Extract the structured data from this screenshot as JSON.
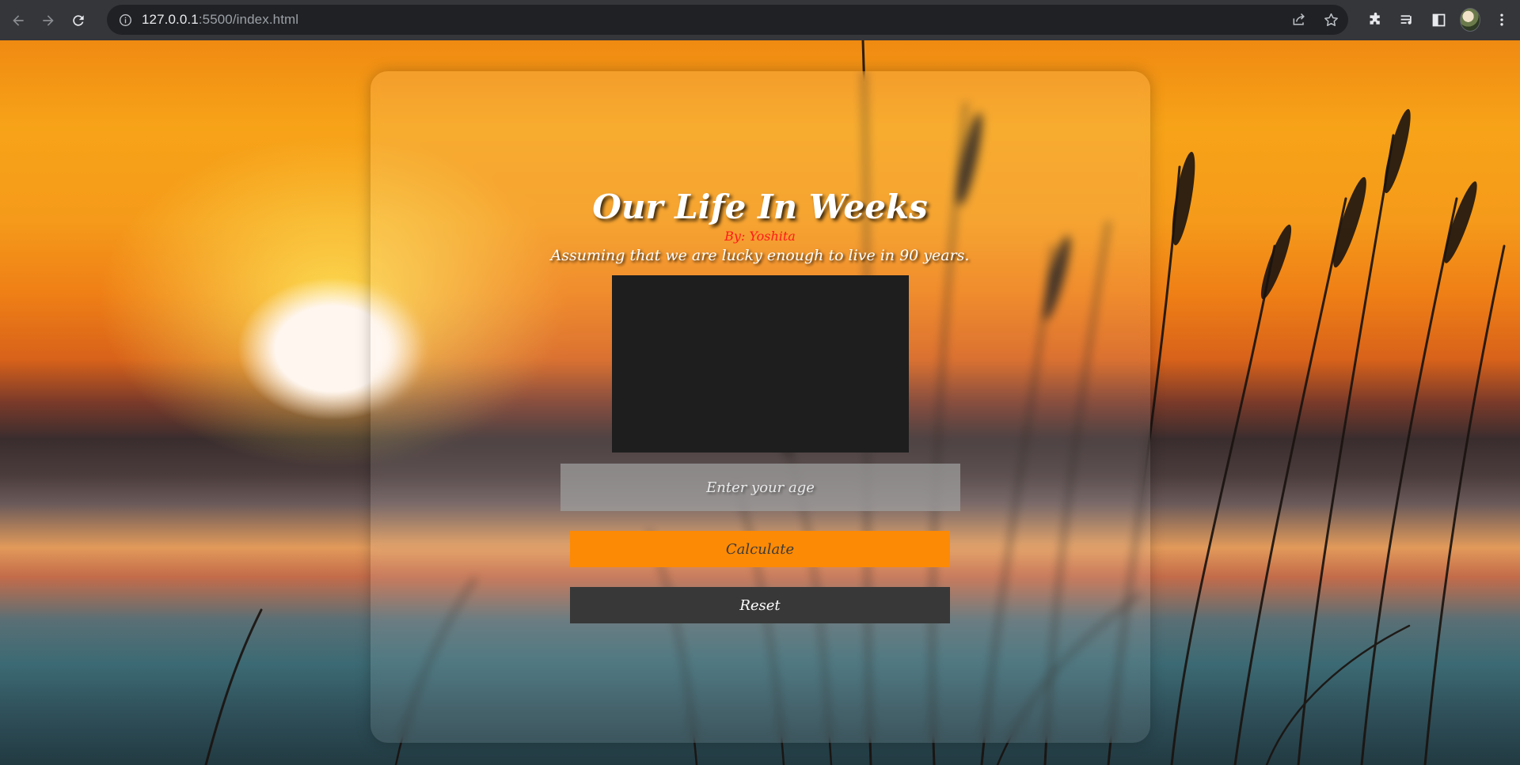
{
  "browser": {
    "url_host": "127.0.0.1",
    "url_rest": ":5500/index.html"
  },
  "page": {
    "title": "Our Life In Weeks",
    "byline": "By: Yoshita",
    "subtitle": "Assuming that we are lucky enough to live in 90 years.",
    "age_input": {
      "placeholder": "Enter your age",
      "value": ""
    },
    "calculate_label": "Calculate",
    "reset_label": "Reset"
  },
  "colors": {
    "calculate_bg": "#fd8a05",
    "reset_bg": "#383838",
    "byline": "#ff1a1a",
    "canvas_bg": "#1e1e1e"
  },
  "icons": [
    "back-icon",
    "forward-icon",
    "reload-icon",
    "info-icon",
    "share-icon",
    "bookmark-star-icon",
    "extensions-icon",
    "reading-list-icon",
    "side-panel-icon",
    "profile-avatar",
    "menu-icon"
  ]
}
